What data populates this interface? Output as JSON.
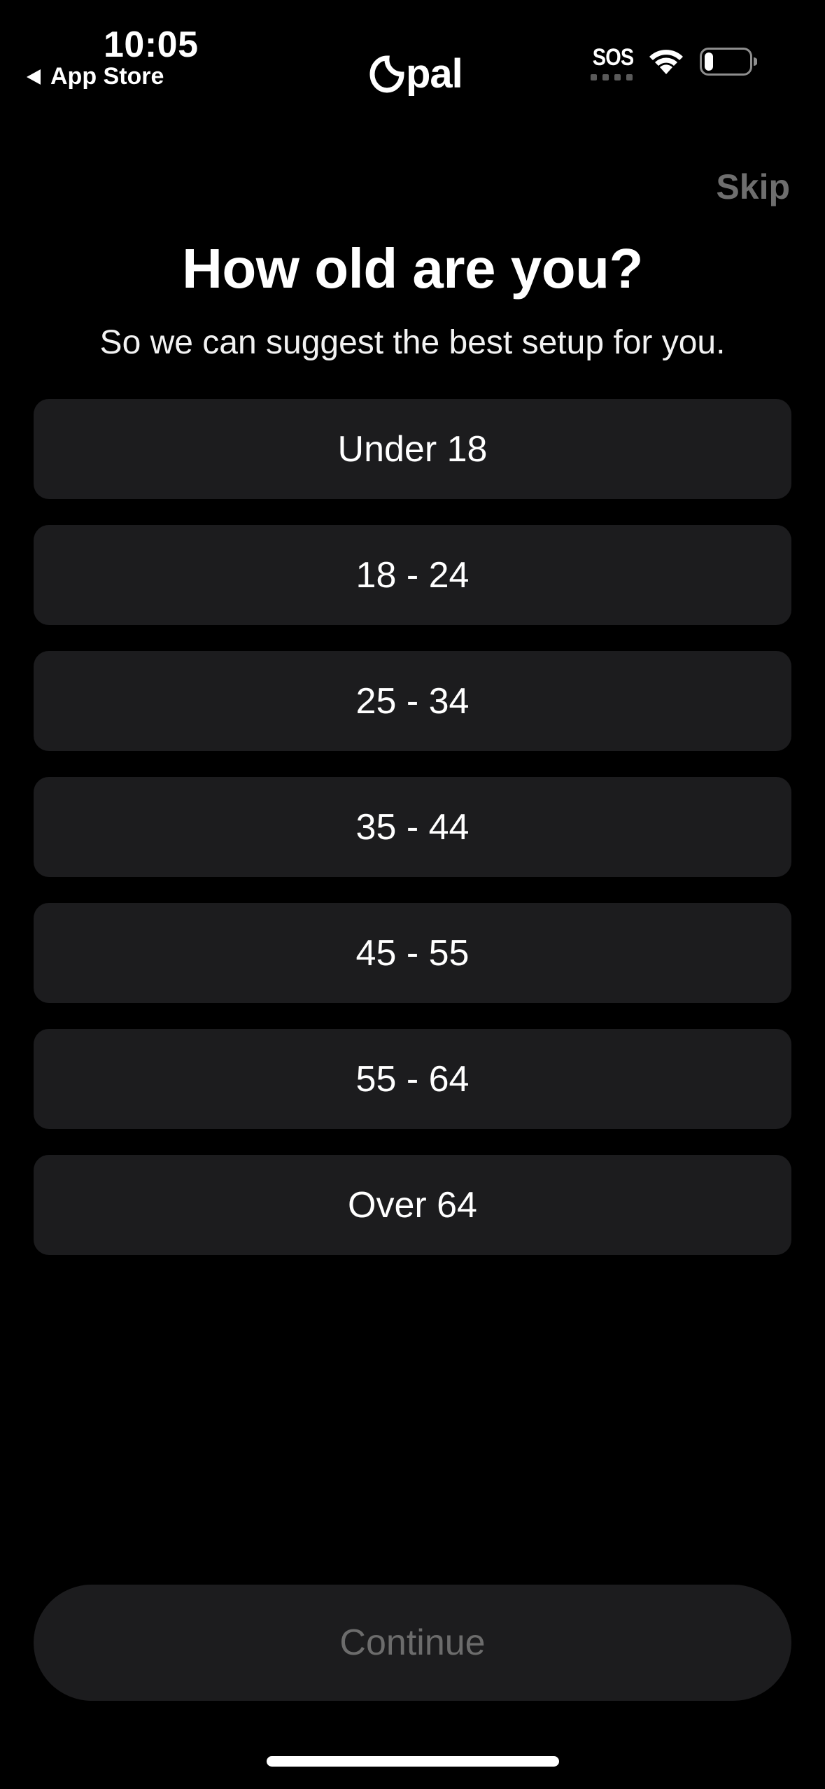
{
  "status_bar": {
    "time": "10:05",
    "back_app": "App Store",
    "sos": "SOS",
    "icons": [
      "sos-icon",
      "wifi-icon",
      "battery-icon"
    ],
    "battery_level": 0.2
  },
  "header": {
    "logo": "Opal",
    "skip_label": "Skip"
  },
  "question": {
    "title": "How old are you?",
    "subtitle": "So we can suggest the best setup for you."
  },
  "options": [
    {
      "label": "Under 18"
    },
    {
      "label": "18 - 24"
    },
    {
      "label": "25 - 34"
    },
    {
      "label": "35 - 44"
    },
    {
      "label": "45 - 55"
    },
    {
      "label": "55 - 64"
    },
    {
      "label": "Over 64"
    }
  ],
  "footer": {
    "continue_label": "Continue",
    "continue_enabled": false
  },
  "colors": {
    "background": "#000000",
    "card": "#1c1c1e",
    "muted_text": "#6e6e6e",
    "text": "#ffffff"
  }
}
